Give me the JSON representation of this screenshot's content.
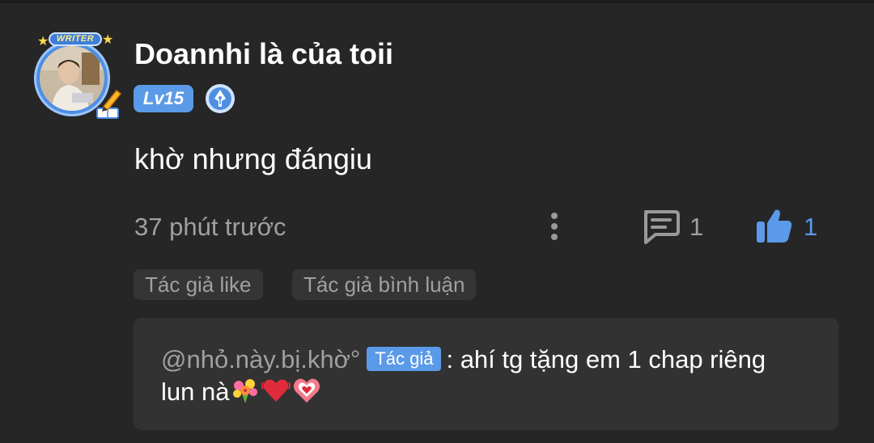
{
  "comment": {
    "author": {
      "name": "Doannhi là của toii",
      "avatar_badge": "WRITER",
      "level": "Lv15",
      "writer_badge_icon": "fountain-pen-icon"
    },
    "text": "khờ nhưng đángiu",
    "timestamp": "37 phút trước",
    "actions": {
      "more_icon": "more-vertical-icon",
      "reply_icon": "comment-icon",
      "reply_count": "1",
      "like_icon": "thumbs-up-icon",
      "like_count": "1"
    },
    "tags": [
      "Tác giả like",
      "Tác giả bình luận"
    ],
    "reply": {
      "handle": "@nhỏ.này.bị.khờ°",
      "author_chip": "Tác giả",
      "text_line1": ": ahí tg tặng em 1 chap riêng",
      "text_line2": "lun nà",
      "emojis": [
        "bouquet-icon",
        "red-heart-icon",
        "sparkling-heart-icon"
      ]
    }
  },
  "colors": {
    "background": "#262626",
    "accent": "#5b9ae8",
    "muted_text": "#a0a0a0",
    "chip_background": "#353535",
    "reply_background": "#323232"
  }
}
